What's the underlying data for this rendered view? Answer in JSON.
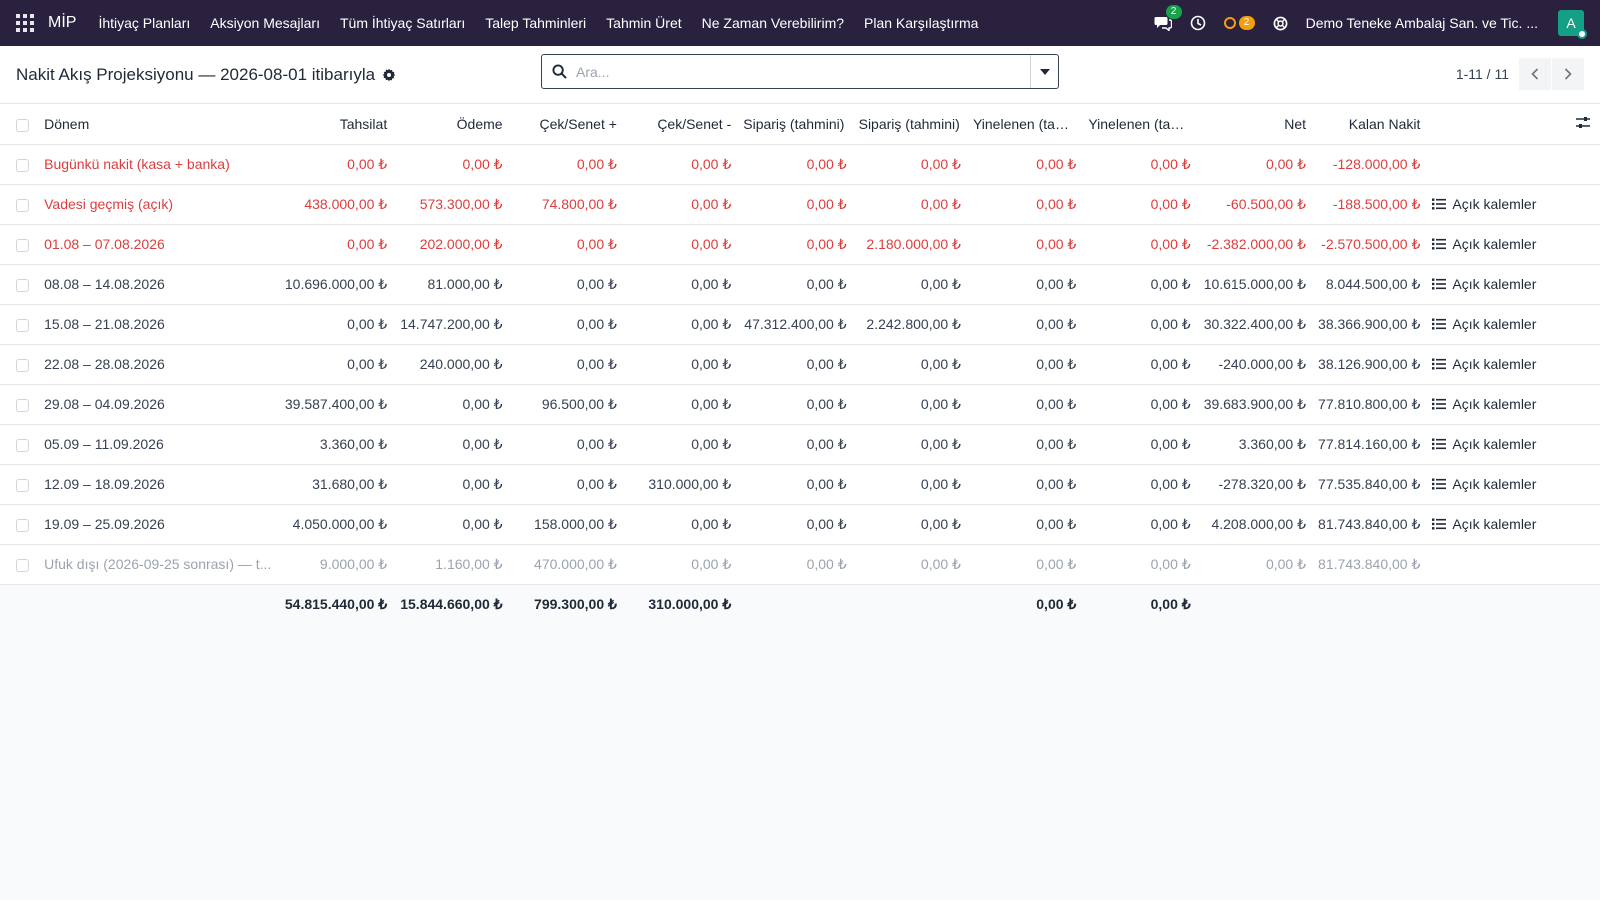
{
  "navbar": {
    "brand": "MİP",
    "menu": [
      "İhtiyaç Planları",
      "Aksiyon Mesajları",
      "Tüm İhtiyaç Satırları",
      "Talep Tahminleri",
      "Tahmin Üret",
      "Ne Zaman Verebilirim?",
      "Plan Karşılaştırma"
    ],
    "messages_count": "2",
    "activities_count": "2",
    "company": "Demo Teneke Ambalaj San. ve Tic. ...",
    "avatar_initial": "A"
  },
  "control": {
    "title": "Nakit Akış Projeksiyonu — 2026-08-01 itibarıyla",
    "search_placeholder": "Ara...",
    "pager": "1-11 / 11"
  },
  "table": {
    "headers": [
      "Dönem",
      "Tahsilat",
      "Ödeme",
      "Çek/Senet +",
      "Çek/Senet -",
      "Sipariş (tahmini)",
      "Sipariş (tahmini)",
      "Yinelenen (tahsilat)",
      "Yinelenen (tahsilat)",
      "Net",
      "Kalan Nakit"
    ],
    "rows": [
      {
        "style": "red",
        "cells": [
          "Bugünkü nakit (kasa + banka)",
          "0,00 ₺",
          "0,00 ₺",
          "0,00 ₺",
          "0,00 ₺",
          "0,00 ₺",
          "0,00 ₺",
          "0,00 ₺",
          "0,00 ₺",
          "0,00 ₺",
          "-128.000,00 ₺"
        ],
        "action": ""
      },
      {
        "style": "red",
        "cells": [
          "Vadesi geçmiş (açık)",
          "438.000,00 ₺",
          "573.300,00 ₺",
          "74.800,00 ₺",
          "0,00 ₺",
          "0,00 ₺",
          "0,00 ₺",
          "0,00 ₺",
          "0,00 ₺",
          "-60.500,00 ₺",
          "-188.500,00 ₺"
        ],
        "action": "Açık kalemler"
      },
      {
        "style": "red",
        "cells": [
          "01.08 – 07.08.2026",
          "0,00 ₺",
          "202.000,00 ₺",
          "0,00 ₺",
          "0,00 ₺",
          "0,00 ₺",
          "2.180.000,00 ₺",
          "0,00 ₺",
          "0,00 ₺",
          "-2.382.000,00 ₺",
          "-2.570.500,00 ₺"
        ],
        "action": "Açık kalemler"
      },
      {
        "style": "normal",
        "cells": [
          "08.08 – 14.08.2026",
          "10.696.000,00 ₺",
          "81.000,00 ₺",
          "0,00 ₺",
          "0,00 ₺",
          "0,00 ₺",
          "0,00 ₺",
          "0,00 ₺",
          "0,00 ₺",
          "10.615.000,00 ₺",
          "8.044.500,00 ₺"
        ],
        "action": "Açık kalemler"
      },
      {
        "style": "normal",
        "cells": [
          "15.08 – 21.08.2026",
          "0,00 ₺",
          "14.747.200,00 ₺",
          "0,00 ₺",
          "0,00 ₺",
          "47.312.400,00 ₺",
          "2.242.800,00 ₺",
          "0,00 ₺",
          "0,00 ₺",
          "30.322.400,00 ₺",
          "38.366.900,00 ₺"
        ],
        "action": "Açık kalemler"
      },
      {
        "style": "normal",
        "cells": [
          "22.08 – 28.08.2026",
          "0,00 ₺",
          "240.000,00 ₺",
          "0,00 ₺",
          "0,00 ₺",
          "0,00 ₺",
          "0,00 ₺",
          "0,00 ₺",
          "0,00 ₺",
          "-240.000,00 ₺",
          "38.126.900,00 ₺"
        ],
        "action": "Açık kalemler"
      },
      {
        "style": "normal",
        "cells": [
          "29.08 – 04.09.2026",
          "39.587.400,00 ₺",
          "0,00 ₺",
          "96.500,00 ₺",
          "0,00 ₺",
          "0,00 ₺",
          "0,00 ₺",
          "0,00 ₺",
          "0,00 ₺",
          "39.683.900,00 ₺",
          "77.810.800,00 ₺"
        ],
        "action": "Açık kalemler"
      },
      {
        "style": "normal",
        "cells": [
          "05.09 – 11.09.2026",
          "3.360,00 ₺",
          "0,00 ₺",
          "0,00 ₺",
          "0,00 ₺",
          "0,00 ₺",
          "0,00 ₺",
          "0,00 ₺",
          "0,00 ₺",
          "3.360,00 ₺",
          "77.814.160,00 ₺"
        ],
        "action": "Açık kalemler"
      },
      {
        "style": "normal",
        "cells": [
          "12.09 – 18.09.2026",
          "31.680,00 ₺",
          "0,00 ₺",
          "0,00 ₺",
          "310.000,00 ₺",
          "0,00 ₺",
          "0,00 ₺",
          "0,00 ₺",
          "0,00 ₺",
          "-278.320,00 ₺",
          "77.535.840,00 ₺"
        ],
        "action": "Açık kalemler"
      },
      {
        "style": "normal",
        "cells": [
          "19.09 – 25.09.2026",
          "4.050.000,00 ₺",
          "0,00 ₺",
          "158.000,00 ₺",
          "0,00 ₺",
          "0,00 ₺",
          "0,00 ₺",
          "0,00 ₺",
          "0,00 ₺",
          "4.208.000,00 ₺",
          "81.743.840,00 ₺"
        ],
        "action": "Açık kalemler"
      },
      {
        "style": "muted",
        "cells": [
          "Ufuk dışı (2026-09-25 sonrası) — t...",
          "9.000,00 ₺",
          "1.160,00 ₺",
          "470.000,00 ₺",
          "0,00 ₺",
          "0,00 ₺",
          "0,00 ₺",
          "0,00 ₺",
          "0,00 ₺",
          "0,00 ₺",
          "81.743.840,00 ₺"
        ],
        "action": ""
      }
    ],
    "totals": [
      "",
      "54.815.440,00 ₺",
      "15.844.660,00 ₺",
      "799.300,00 ₺",
      "310.000,00 ₺",
      "",
      "",
      "0,00 ₺",
      "0,00 ₺",
      "",
      ""
    ]
  }
}
